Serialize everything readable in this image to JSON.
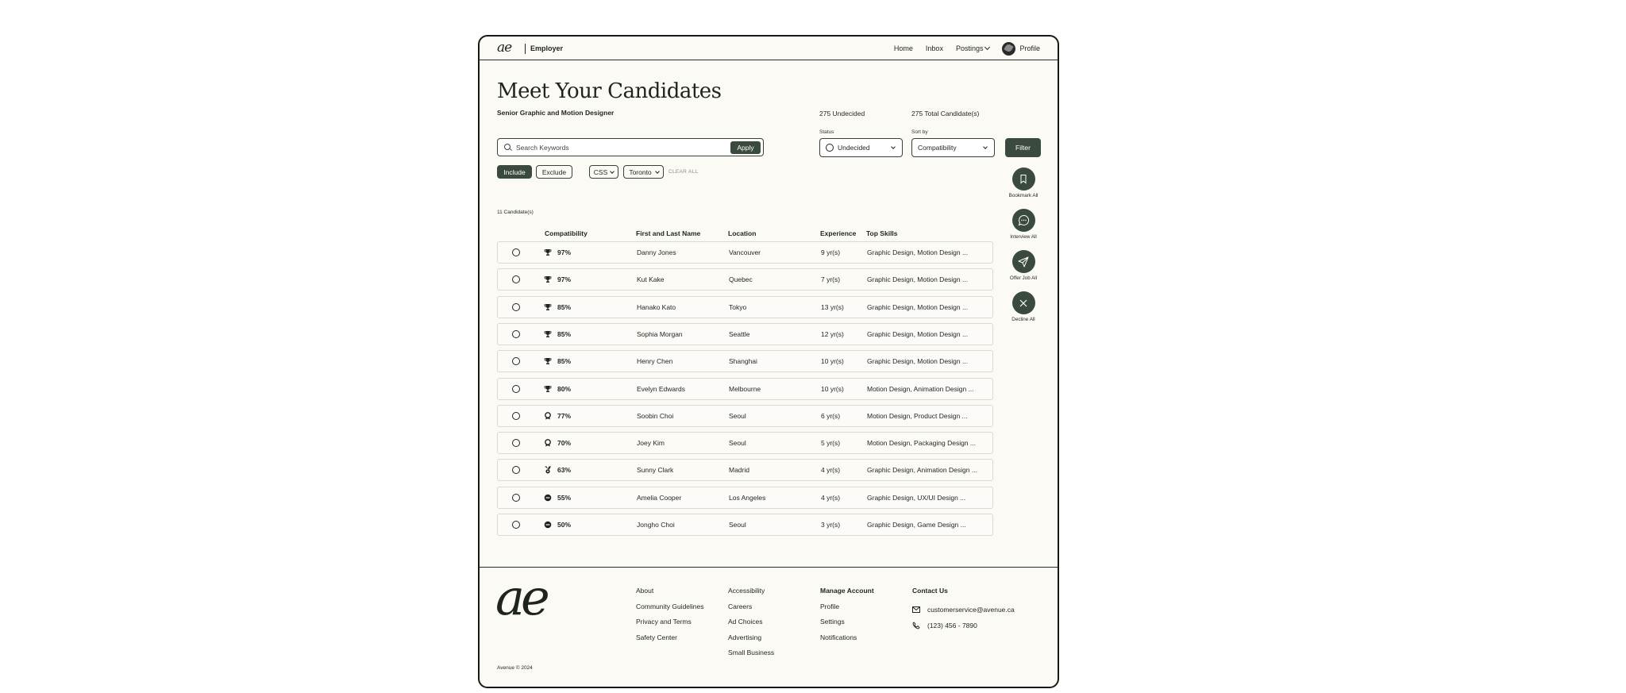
{
  "header": {
    "logo": "ae",
    "brand_label": "Employer",
    "nav": {
      "home": "Home",
      "inbox": "Inbox",
      "postings": "Postings",
      "profile": "Profile"
    }
  },
  "page": {
    "title": "Meet Your Candidates",
    "job_title": "Senior Graphic and Motion Designer",
    "undecided_count": "275 Undecided",
    "total_count": "275 Total Candidate(s)"
  },
  "search": {
    "placeholder": "Search Keywords",
    "value": "",
    "apply_label": "Apply"
  },
  "filters": {
    "include_label": "Include",
    "exclude_label": "Exclude",
    "active": [
      "CSS",
      "Toronto"
    ],
    "clear_all": "CLEAR ALL"
  },
  "status": {
    "label": "Status",
    "value": "Undecided"
  },
  "sort": {
    "label": "Sort by",
    "value": "Compatibility"
  },
  "filter_button": "Filter",
  "side_actions": {
    "bookmark": "Bookmark All",
    "interview": "Interview All",
    "offer": "Offer Job All",
    "decline": "Decline All"
  },
  "candidate_count": "11 Candidate(s)",
  "table": {
    "headers": {
      "compatibility": "Compatibility",
      "name": "First and Last Name",
      "location": "Location",
      "experience": "Experience",
      "skills": "Top Skills"
    },
    "rows": [
      {
        "badge": "trophy-icon",
        "compatibility": "97%",
        "name": "Danny Jones",
        "location": "Vancouver",
        "experience": "9 yr(s)",
        "skills": "Graphic Design, Motion Design ..."
      },
      {
        "badge": "trophy-icon",
        "compatibility": "97%",
        "name": "Kut Kake",
        "location": "Quebec",
        "experience": "7 yr(s)",
        "skills": "Graphic Design, Motion Design ..."
      },
      {
        "badge": "trophy-icon",
        "compatibility": "85%",
        "name": "Hanako Kato",
        "location": "Tokyo",
        "experience": "13 yr(s)",
        "skills": "Graphic Design, Motion Design ..."
      },
      {
        "badge": "trophy-icon",
        "compatibility": "85%",
        "name": "Sophia Morgan",
        "location": "Seattle",
        "experience": "12 yr(s)",
        "skills": "Graphic Design, Motion Design ..."
      },
      {
        "badge": "trophy-icon",
        "compatibility": "85%",
        "name": "Henry Chen",
        "location": "Shanghai",
        "experience": "10 yr(s)",
        "skills": "Graphic Design, Motion Design ..."
      },
      {
        "badge": "trophy-icon",
        "compatibility": "80%",
        "name": "Evelyn Edwards",
        "location": "Melbourne",
        "experience": "10 yr(s)",
        "skills": "Motion Design, Animation Design ..."
      },
      {
        "badge": "rosette-icon",
        "compatibility": "77%",
        "name": "Soobin Choi",
        "location": "Seoul",
        "experience": "6 yr(s)",
        "skills": "Motion Design, Product Design ..."
      },
      {
        "badge": "rosette-icon",
        "compatibility": "70%",
        "name": "Joey Kim",
        "location": "Seoul",
        "experience": "5 yr(s)",
        "skills": "Motion Design, Packaging Design ..."
      },
      {
        "badge": "medal-icon",
        "compatibility": "63%",
        "name": "Sunny Clark",
        "location": "Madrid",
        "experience": "4 yr(s)",
        "skills": "Graphic Design, Animation Design ..."
      },
      {
        "badge": "minus-circle-icon",
        "compatibility": "55%",
        "name": "Amelia Cooper",
        "location": "Los Angeles",
        "experience": "4 yr(s)",
        "skills": "Graphic Design, UX/UI Design ..."
      },
      {
        "badge": "minus-circle-icon",
        "compatibility": "50%",
        "name": "Jongho Choi",
        "location": "Seoul",
        "experience": "3 yr(s)",
        "skills": "Graphic Design, Game Design ..."
      }
    ]
  },
  "footer": {
    "logo": "ae",
    "col1": [
      "About",
      "Community Guidelines",
      "Privacy and Terms",
      "Safety Center"
    ],
    "col2": [
      "Accessibility",
      "Careers",
      "Ad Choices",
      "Advertising",
      "Small Business"
    ],
    "manage": {
      "title": "Manage Account",
      "items": [
        "Profile",
        "Settings",
        "Notifications"
      ]
    },
    "contact": {
      "title": "Contact Us",
      "email": "customerservice@avenue.ca",
      "phone": "(123) 456 - 7890"
    },
    "copyright": "Avenue © 2024"
  },
  "colors": {
    "accent": "#3a4a3e",
    "background": "#fbfaf5",
    "border": "#161a16"
  }
}
